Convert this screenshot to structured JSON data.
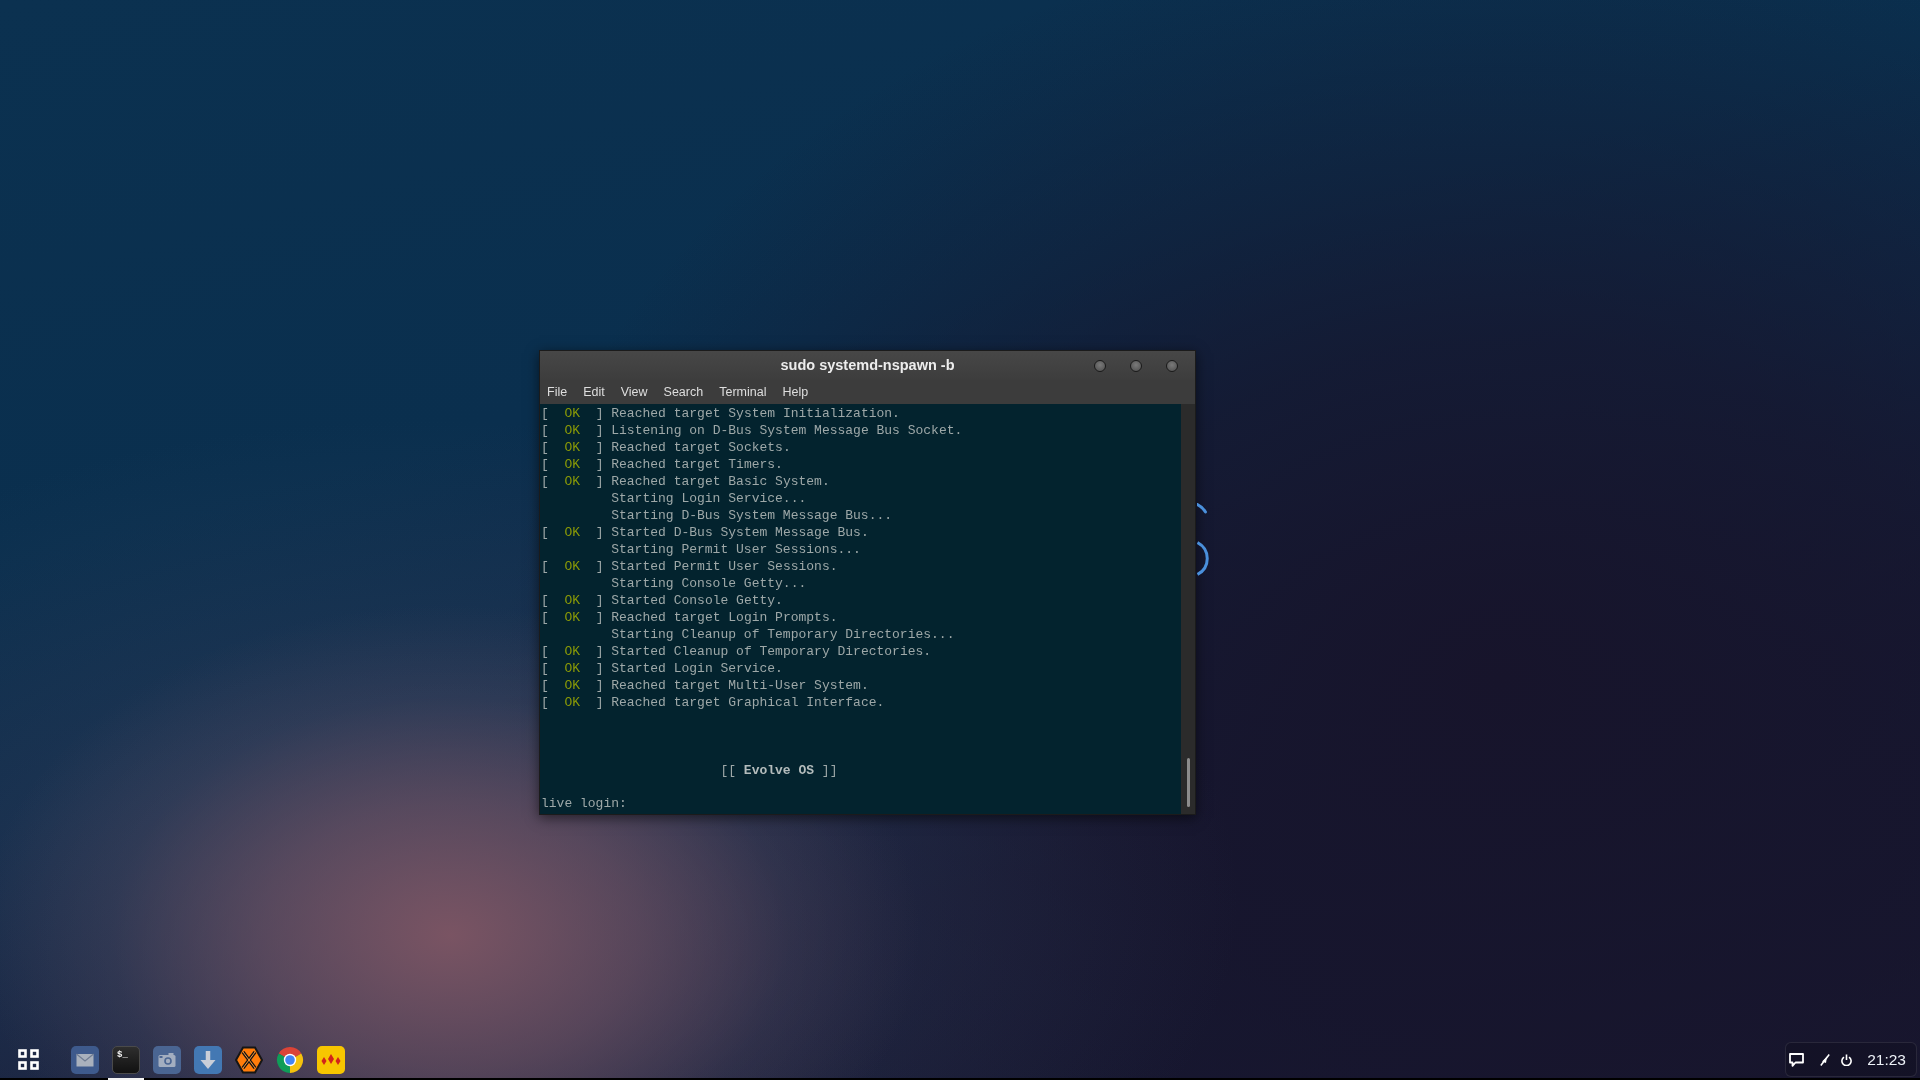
{
  "window": {
    "title": "sudo systemd-nspawn -b",
    "menu": [
      "File",
      "Edit",
      "View",
      "Search",
      "Terminal",
      "Help"
    ],
    "console": {
      "lines": [
        {
          "kind": "status",
          "open": "[",
          "status": "OK",
          "close": "]",
          "text": "Reached target System Initialization."
        },
        {
          "kind": "status",
          "open": "[",
          "status": "OK",
          "close": "]",
          "text": "Listening on D-Bus System Message Bus Socket."
        },
        {
          "kind": "status",
          "open": "[",
          "status": "OK",
          "close": "]",
          "text": "Reached target Sockets."
        },
        {
          "kind": "status",
          "open": "[",
          "status": "OK",
          "close": "]",
          "text": "Reached target Timers."
        },
        {
          "kind": "status",
          "open": "[",
          "status": "OK",
          "close": "]",
          "text": "Reached target Basic System."
        },
        {
          "kind": "plain",
          "text": "Starting Login Service..."
        },
        {
          "kind": "plain",
          "text": "Starting D-Bus System Message Bus..."
        },
        {
          "kind": "status",
          "open": "[",
          "status": "OK",
          "close": "]",
          "text": "Started D-Bus System Message Bus."
        },
        {
          "kind": "plain",
          "text": "Starting Permit User Sessions..."
        },
        {
          "kind": "status",
          "open": "[",
          "status": "OK",
          "close": "]",
          "text": "Started Permit User Sessions."
        },
        {
          "kind": "plain",
          "text": "Starting Console Getty..."
        },
        {
          "kind": "status",
          "open": "[",
          "status": "OK",
          "close": "]",
          "text": "Started Console Getty."
        },
        {
          "kind": "status",
          "open": "[",
          "status": "OK",
          "close": "]",
          "text": "Reached target Login Prompts."
        },
        {
          "kind": "plain",
          "text": "Starting Cleanup of Temporary Directories..."
        },
        {
          "kind": "status",
          "open": "[",
          "status": "OK",
          "close": "]",
          "text": "Started Cleanup of Temporary Directories."
        },
        {
          "kind": "status",
          "open": "[",
          "status": "OK",
          "close": "]",
          "text": "Started Login Service."
        },
        {
          "kind": "status",
          "open": "[",
          "status": "OK",
          "close": "]",
          "text": "Reached target Multi-User System."
        },
        {
          "kind": "status",
          "open": "[",
          "status": "OK",
          "close": "]",
          "text": "Reached target Graphical Interface."
        }
      ],
      "banner": "[[ **Evolve OS** ]]",
      "prompt": "live login:"
    }
  },
  "taskbar": {
    "apps": [
      {
        "kind": "mail",
        "active": false
      },
      {
        "kind": "terminal",
        "glyph": "$_",
        "active": true
      },
      {
        "kind": "camera",
        "active": false
      },
      {
        "kind": "download",
        "active": false
      },
      {
        "kind": "hexagon",
        "active": false
      },
      {
        "kind": "browser",
        "active": false
      },
      {
        "kind": "diamonds",
        "active": false
      }
    ],
    "tray": {
      "clock": "21:23"
    }
  }
}
